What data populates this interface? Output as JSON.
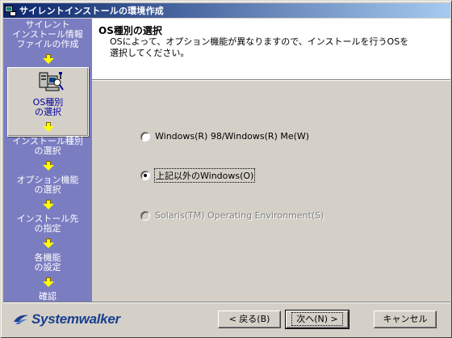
{
  "window": {
    "title": "サイレントインストールの環境作成"
  },
  "sidebar": {
    "steps": [
      {
        "lines": [
          "サイレント",
          "インストール情報",
          "ファイルの作成"
        ]
      },
      {
        "lines": [
          "OS種別",
          "の選択"
        ],
        "current": true
      },
      {
        "lines": [
          "インストール種別",
          "の選択"
        ]
      },
      {
        "lines": [
          "オプション機能",
          "の選択"
        ]
      },
      {
        "lines": [
          "インストール先",
          "の指定"
        ]
      },
      {
        "lines": [
          "各機能",
          "の設定"
        ]
      },
      {
        "lines": [
          "確認"
        ]
      }
    ]
  },
  "header": {
    "title": "OS種別の選択",
    "desc_line1": "OSによって、オプション機能が異なりますので、インストールを行うOSを",
    "desc_line2": "選択してください。"
  },
  "options": [
    {
      "label": "Windows(R) 98/Windows(R) Me(W)",
      "checked": false,
      "disabled": false
    },
    {
      "label": "上記以外のWindows(O)",
      "checked": true,
      "disabled": false
    },
    {
      "label": "Solaris(TM) Operating Environment(S)",
      "checked": false,
      "disabled": true
    }
  ],
  "footer": {
    "brand": "Systemwalker",
    "back_label": "< 戻る(B)",
    "next_label": "次へ(N) >",
    "cancel_label": "キャンセル"
  },
  "colors": {
    "sidebar": "#7b7dc1",
    "arrow": "#ffff00",
    "titlebar_start": "#0a246a",
    "titlebar_end": "#a6caf0",
    "brand": "#1a3f8f"
  }
}
